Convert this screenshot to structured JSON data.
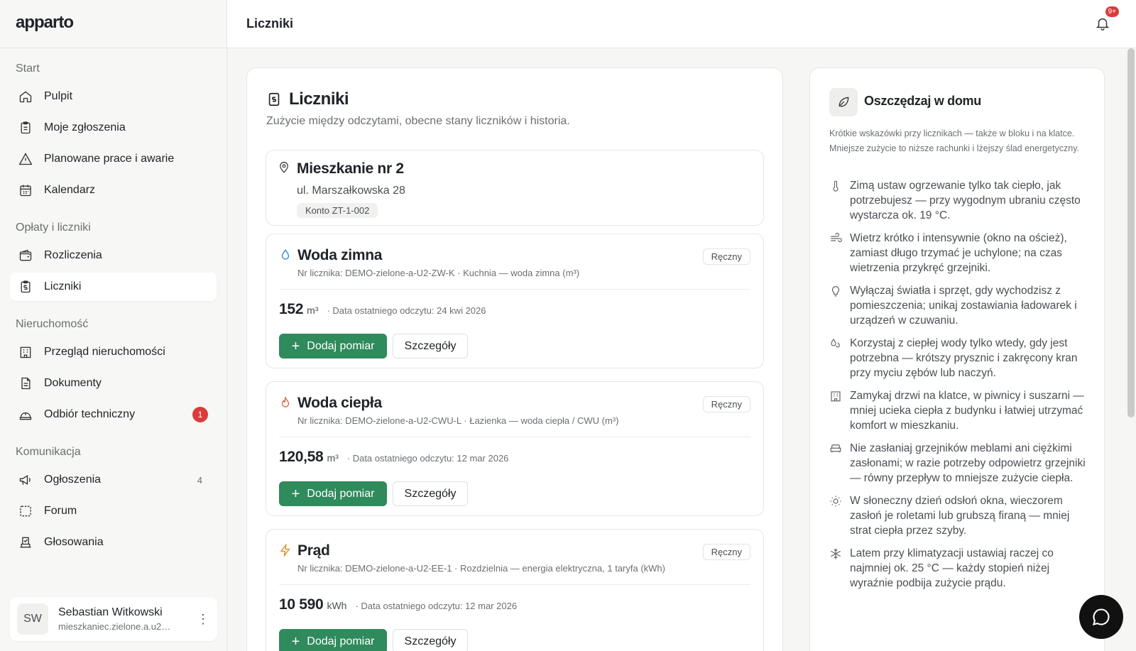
{
  "app": {
    "logo": "apparto",
    "page_title": "Liczniki",
    "notifications_badge": "9+"
  },
  "sidebar": {
    "sections": [
      {
        "label": "Start",
        "items": [
          {
            "label": "Pulpit",
            "icon": "home-icon"
          },
          {
            "label": "Moje zgłoszenia",
            "icon": "clipboard-icon"
          },
          {
            "label": "Planowane prace i awarie",
            "icon": "warning-icon"
          },
          {
            "label": "Kalendarz",
            "icon": "calendar-icon"
          }
        ]
      },
      {
        "label": "Opłaty i liczniki",
        "items": [
          {
            "label": "Rozliczenia",
            "icon": "wallet-icon"
          },
          {
            "label": "Liczniki",
            "icon": "meter-icon",
            "active": true
          }
        ]
      },
      {
        "label": "Nieruchomość",
        "items": [
          {
            "label": "Przegląd nieruchomości",
            "icon": "building-icon"
          },
          {
            "label": "Dokumenty",
            "icon": "document-icon"
          },
          {
            "label": "Odbiór techniczny",
            "icon": "helmet-icon",
            "badge": "1"
          }
        ]
      },
      {
        "label": "Komunikacja",
        "items": [
          {
            "label": "Ogłoszenia",
            "icon": "megaphone-icon",
            "count": "4"
          },
          {
            "label": "Forum",
            "icon": "forum-icon"
          },
          {
            "label": "Głosowania",
            "icon": "ballot-icon"
          }
        ]
      }
    ]
  },
  "user": {
    "initials": "SW",
    "name": "Sebastian Witkowski",
    "email": "mieszkaniec.zielone.a.u2…"
  },
  "main": {
    "title": "Liczniki",
    "subtitle": "Zużycie między odczytami, obecne stany liczników i historia.",
    "property": {
      "title": "Mieszkanie nr 2",
      "street": "ul. Marszałkowska 28",
      "account": "Konto ZT-1-002"
    },
    "meters": [
      {
        "title": "Woda zimna",
        "icon": "water-drop-icon",
        "icon_color": "#2f7fd6",
        "desc": "Nr licznika: DEMO-zielone-a-U2-ZW-K · Kuchnia — woda zimna (m³)",
        "mode": "Ręczny",
        "value": "152",
        "unit": "m³",
        "date": "· Data ostatniego odczytu: 24 kwi 2026",
        "add_label": "Dodaj pomiar",
        "details_label": "Szczegóły"
      },
      {
        "title": "Woda ciepła",
        "icon": "flame-icon",
        "icon_color": "#e0603a",
        "desc": "Nr licznika: DEMO-zielone-a-U2-CWU-L · Łazienka — woda ciepła / CWU (m³)",
        "mode": "Ręczny",
        "value": "120,58",
        "unit": "m³",
        "date": "· Data ostatniego odczytu: 12 mar 2026",
        "add_label": "Dodaj pomiar",
        "details_label": "Szczegóły"
      },
      {
        "title": "Prąd",
        "icon": "lightning-icon",
        "icon_color": "#e08a1e",
        "desc": "Nr licznika: DEMO-zielone-a-U2-EE-1 · Rozdzielnia — energia elektryczna, 1 taryfa (kWh)",
        "mode": "Ręczny",
        "value": "10 590",
        "unit": "kWh",
        "date": "· Data ostatniego odczytu: 12 mar 2026",
        "add_label": "Dodaj pomiar",
        "details_label": "Szczegóły"
      }
    ]
  },
  "tips": {
    "title": "Oszczędzaj w domu",
    "intro": "Krótkie wskazówki przy licznikach — także w bloku i na klatce. Mniejsze zużycie to niższe rachunki i lżejszy ślad energetyczny.",
    "items": [
      {
        "icon": "thermometer-icon",
        "text": "Zimą ustaw ogrzewanie tylko tak ciepło, jak potrzebujesz — przy wygodnym ubraniu często wystarcza ok. 19 °C."
      },
      {
        "icon": "wind-icon",
        "text": "Wietrz krótko i intensywnie (okno na oścież), zamiast długo trzymać je uchylone; na czas wietrzenia przykręć grzejniki."
      },
      {
        "icon": "lightbulb-icon",
        "text": "Wyłączaj światła i sprzęt, gdy wychodzisz z pomieszczenia; unikaj zostawiania ładowarek i urządzeń w czuwaniu."
      },
      {
        "icon": "water-drops-icon",
        "text": "Korzystaj z ciepłej wody tylko wtedy, gdy jest potrzebna — krótszy prysznic i zakręcony kran przy myciu zębów lub naczyń."
      },
      {
        "icon": "building-icon",
        "text": "Zamykaj drzwi na klatce, w piwnicy i suszarni — mniej ucieka ciepła z budynku i łatwiej utrzymać komfort w mieszkaniu."
      },
      {
        "icon": "sofa-icon",
        "text": "Nie zasłaniaj grzejników meblami ani ciężkimi zasłonami; w razie potrzeby odpowietrz grzejniki — równy przepływ to mniejsze zużycie ciepła."
      },
      {
        "icon": "sun-icon",
        "text": "W słoneczny dzień odsłoń okna, wieczorem zasłoń je roletami lub grubszą firaną — mniej strat ciepła przez szyby."
      },
      {
        "icon": "snowflake-icon",
        "text": "Latem przy klimatyzacji ustawiaj raczej co najmniej ok. 25 °C — każdy stopień niżej wyraźnie podbija zużycie prądu."
      }
    ]
  }
}
